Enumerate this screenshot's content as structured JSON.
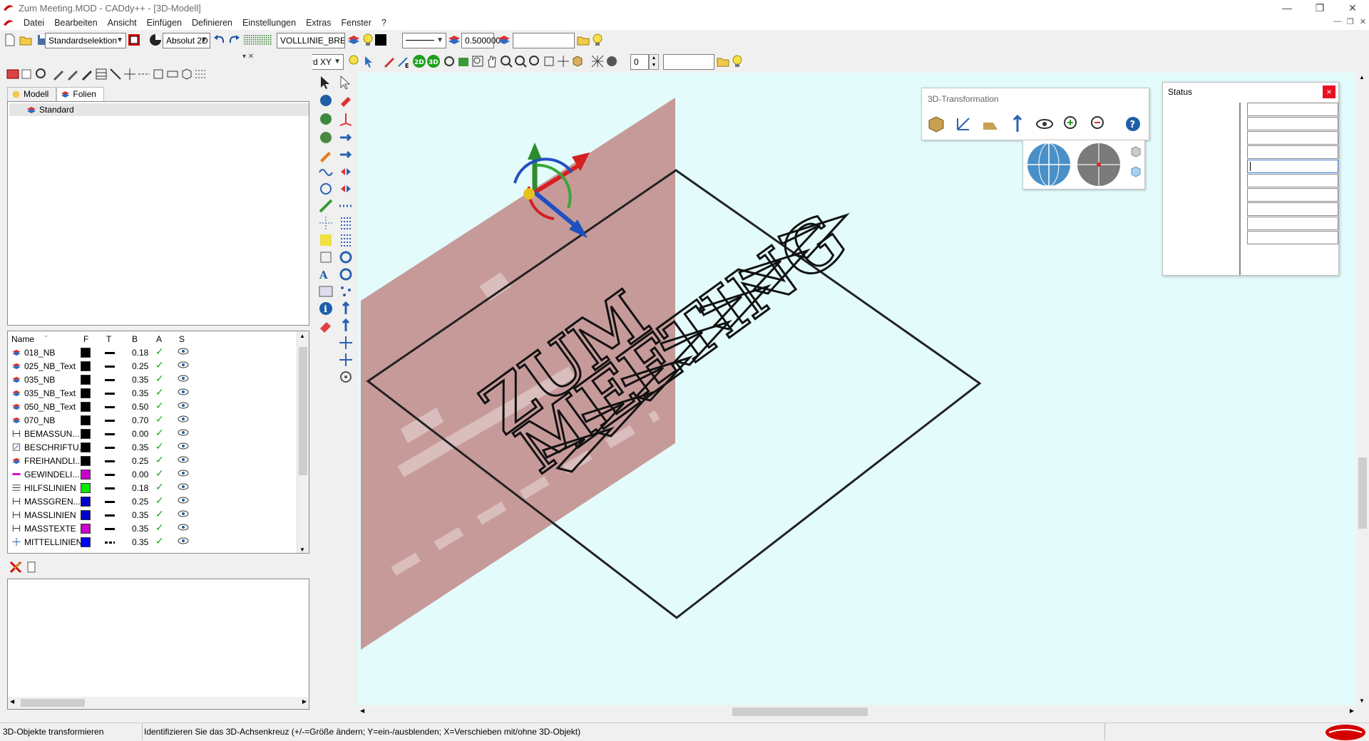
{
  "window": {
    "title": "Zum Meeting.MOD  -  CADdy++ - [3D-Modell]",
    "controls": [
      "—",
      "❐",
      "✕"
    ]
  },
  "menu": {
    "items": [
      "Datei",
      "Bearbeiten",
      "Ansicht",
      "Einfügen",
      "Definieren",
      "Einstellungen",
      "Extras",
      "Fenster",
      "?"
    ],
    "mdi_controls": [
      "—",
      "❐",
      "✕"
    ]
  },
  "toolbar1": {
    "selection_mode": "Standardselektion",
    "coord_mode": "Absolut 2D",
    "line_type": "VOLLLINIE_BREIT",
    "line_width": "0.500000",
    "extra_field": ""
  },
  "toolbar2": {
    "view_plane": "Standard XY",
    "layer_number": "0",
    "extra_field": ""
  },
  "left_panel": {
    "tabs": [
      "Modell",
      "Folien"
    ],
    "active_tab": "Folien",
    "folien": [
      "Standard"
    ],
    "layer_columns": [
      "Name",
      "F",
      "T",
      "B",
      "A",
      "S"
    ],
    "layers": [
      {
        "name": "018_NB",
        "color": "#000000",
        "line": "solid",
        "width": "0.18",
        "icon": "layer"
      },
      {
        "name": "025_NB_Text",
        "color": "#000000",
        "line": "solid",
        "width": "0.25",
        "icon": "layer"
      },
      {
        "name": "035_NB",
        "color": "#000000",
        "line": "solid",
        "width": "0.35",
        "icon": "layer"
      },
      {
        "name": "035_NB_Text",
        "color": "#000000",
        "line": "solid",
        "width": "0.35",
        "icon": "layer"
      },
      {
        "name": "050_NB_Text",
        "color": "#000000",
        "line": "solid",
        "width": "0.50",
        "icon": "layer"
      },
      {
        "name": "070_NB",
        "color": "#000000",
        "line": "solid",
        "width": "0.70",
        "icon": "layer"
      },
      {
        "name": "BEMASSUN...",
        "color": "#000000",
        "line": "solid",
        "width": "0.00",
        "icon": "dimension"
      },
      {
        "name": "BESCHRIFTU...",
        "color": "#000000",
        "line": "solid",
        "width": "0.35",
        "icon": "text"
      },
      {
        "name": "FREIHANDLI...",
        "color": "#000000",
        "line": "solid",
        "width": "0.25",
        "icon": "layer"
      },
      {
        "name": "GEWINDELI...",
        "color": "#cc00cc",
        "line": "solid",
        "width": "0.00",
        "icon": "thread"
      },
      {
        "name": "HILFSLINIEN",
        "color": "#00ee00",
        "line": "solid",
        "width": "0.18",
        "icon": "helpline"
      },
      {
        "name": "MASSGREN...",
        "color": "#0000cc",
        "line": "solid",
        "width": "0.25",
        "icon": "dimension"
      },
      {
        "name": "MASSLINIEN",
        "color": "#0000cc",
        "line": "solid",
        "width": "0.35",
        "icon": "dimension"
      },
      {
        "name": "MASSTEXTE",
        "color": "#cc00cc",
        "line": "solid",
        "width": "0.35",
        "icon": "dimension"
      },
      {
        "name": "MITTELLINIEN",
        "color": "#0000ff",
        "line": "dash",
        "width": "0.35",
        "icon": "centerline"
      }
    ]
  },
  "palette": {
    "title": "3D-Transformation"
  },
  "status_window": {
    "title": "Status",
    "close": "×",
    "field_count": 10
  },
  "statusbar": {
    "left": "3D-Objekte transformieren",
    "message": "Identifizieren Sie das 3D-Achsenkreuz (+/-=Größe ändern; Y=ein-/ausblenden; X=Verschieben mit/ohne 3D-Objekt)"
  },
  "model": {
    "text_line1": "ZUM",
    "text_line2": "MEETING",
    "wall_color": "#c79a9a",
    "background": "#e3fbfb"
  },
  "colors": {
    "accent_red": "#d40000",
    "axis_green": "#2e8b2e",
    "axis_red": "#d42020",
    "axis_blue": "#2050c0"
  }
}
